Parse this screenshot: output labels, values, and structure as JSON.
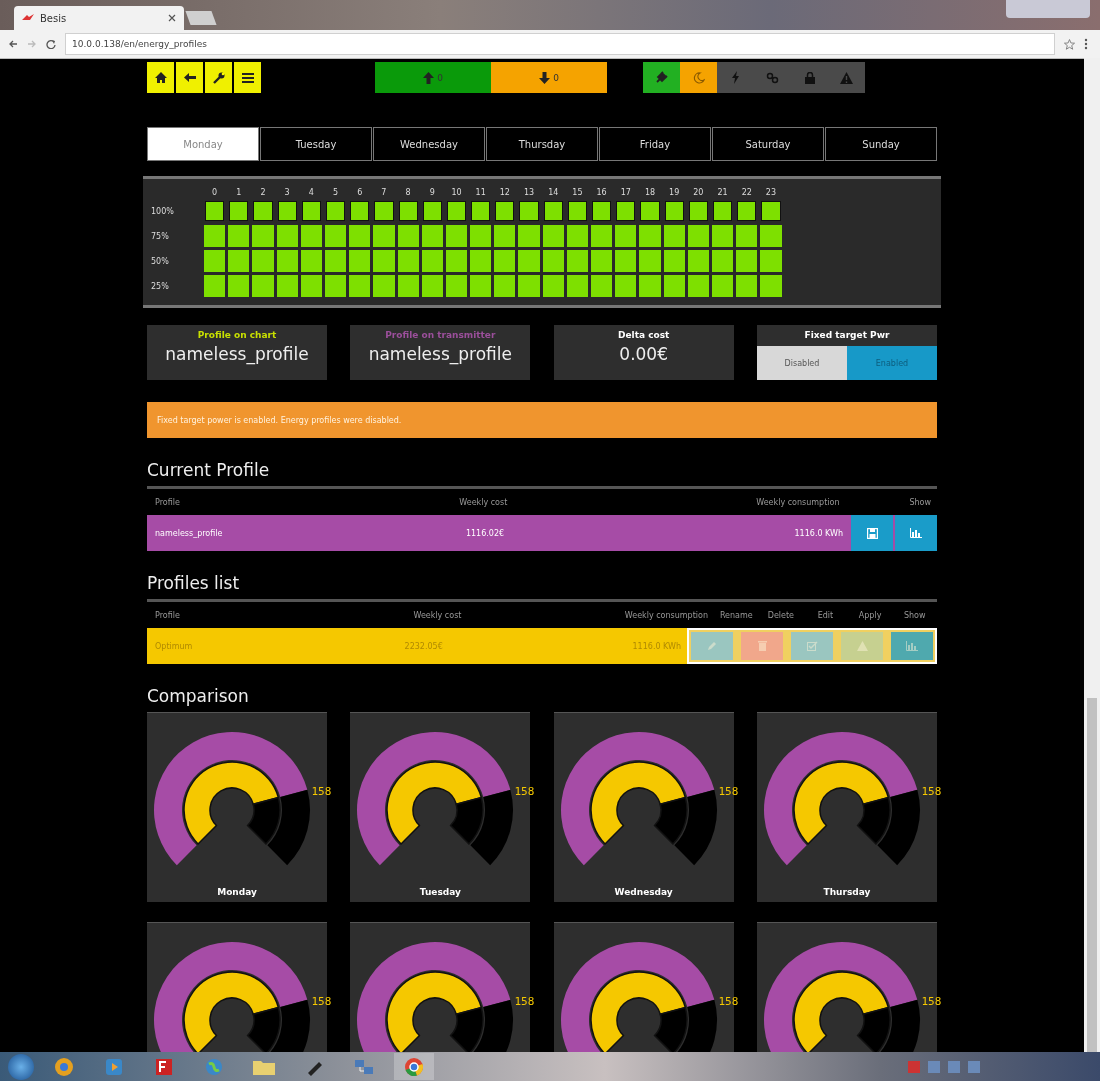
{
  "browser": {
    "tab_title": "Besis",
    "url": "10.0.0.138/en/energy_profiles"
  },
  "counters": [
    {
      "kind": "up",
      "value": "0"
    },
    {
      "kind": "down",
      "value": "0"
    }
  ],
  "status_icons": [
    {
      "color": "#22b022"
    },
    {
      "color": "#f5a300"
    },
    {
      "color": "#4a4a4a"
    },
    {
      "color": "#4a4a4a"
    },
    {
      "color": "#4a4a4a"
    },
    {
      "color": "#4a4a4a"
    }
  ],
  "day_tabs": [
    {
      "label": "Monday",
      "selected": true
    },
    {
      "label": "Tuesday",
      "selected": false
    },
    {
      "label": "Wednesday",
      "selected": false
    },
    {
      "label": "Thursday",
      "selected": false
    },
    {
      "label": "Friday",
      "selected": false
    },
    {
      "label": "Saturday",
      "selected": false
    },
    {
      "label": "Sunday",
      "selected": false
    }
  ],
  "hour_grid": {
    "hours": [
      "0",
      "1",
      "2",
      "3",
      "4",
      "5",
      "6",
      "7",
      "8",
      "9",
      "10",
      "11",
      "12",
      "13",
      "14",
      "15",
      "16",
      "17",
      "18",
      "19",
      "20",
      "21",
      "22",
      "23"
    ],
    "rows": [
      {
        "label": "100%",
        "cells": [
          true,
          true,
          true,
          true,
          true,
          true,
          true,
          true,
          true,
          true,
          true,
          true,
          true,
          true,
          true,
          true,
          true,
          true,
          true,
          true,
          true,
          true,
          true,
          true
        ]
      },
      {
        "label": "75%",
        "cells": [
          true,
          true,
          true,
          true,
          true,
          true,
          true,
          true,
          true,
          true,
          true,
          true,
          true,
          true,
          true,
          true,
          true,
          true,
          true,
          true,
          true,
          true,
          true,
          true
        ]
      },
      {
        "label": "50%",
        "cells": [
          true,
          true,
          true,
          true,
          true,
          true,
          true,
          true,
          true,
          true,
          true,
          true,
          true,
          true,
          true,
          true,
          true,
          true,
          true,
          true,
          true,
          true,
          true,
          true
        ]
      },
      {
        "label": "25%",
        "cells": [
          true,
          true,
          true,
          true,
          true,
          true,
          true,
          true,
          true,
          true,
          true,
          true,
          true,
          true,
          true,
          true,
          true,
          true,
          true,
          true,
          true,
          true,
          true,
          true
        ]
      }
    ]
  },
  "summary": [
    {
      "label": "Profile on chart",
      "value": "nameless_profile",
      "color": "#c8e000"
    },
    {
      "label": "Profile on transmitter",
      "value": "nameless_profile",
      "color": "#9b4f9b"
    },
    {
      "label": "Delta cost",
      "value": "0.00€",
      "color": "#ffffff"
    }
  ],
  "target_power": {
    "label": "Fixed target Pwr",
    "options": [
      {
        "label": "Disabled",
        "selected": false
      },
      {
        "label": "Enabled",
        "selected": true
      }
    ]
  },
  "alert": "Fixed target power is enabled. Energy profiles were disabled.",
  "current_profile": {
    "title": "Current Profile",
    "columns": [
      "Profile",
      "Weekly cost",
      "Weekly consumption",
      "Show"
    ],
    "rows": [
      {
        "color": "#a64ca6",
        "cells": [
          "nameless_profile",
          "1116.02€",
          "1116.0 KWh"
        ],
        "actions": [
          {
            "kind": "save",
            "disabled": false
          },
          {
            "kind": "chart",
            "disabled": false
          }
        ]
      }
    ]
  },
  "profiles_list": {
    "title": "Profiles list",
    "columns": [
      "Profile",
      "Weekly cost",
      "Weekly consumption",
      "Rename",
      "Delete",
      "Edit",
      "Apply",
      "Show"
    ],
    "rows": [
      {
        "color": "#f5c800",
        "cells": [
          "Optimum",
          "2232.05€",
          "1116.0 KWh"
        ],
        "actions": [
          {
            "kind": "rename",
            "disabled": true
          },
          {
            "kind": "delete",
            "disabled": true
          },
          {
            "kind": "edit",
            "disabled": true
          },
          {
            "kind": "apply",
            "disabled": true
          },
          {
            "kind": "chart",
            "disabled": true
          }
        ]
      }
    ]
  },
  "comparison": {
    "title": "Comparison",
    "gauges": [
      {
        "day": "Monday",
        "reading": "158"
      },
      {
        "day": "Tuesday",
        "reading": "158"
      },
      {
        "day": "Wednesday",
        "reading": "158"
      },
      {
        "day": "Thursday",
        "reading": "158"
      },
      {
        "reading": "158"
      },
      {
        "reading": "158"
      },
      {
        "reading": "158"
      },
      {
        "reading": "158"
      }
    ]
  }
}
